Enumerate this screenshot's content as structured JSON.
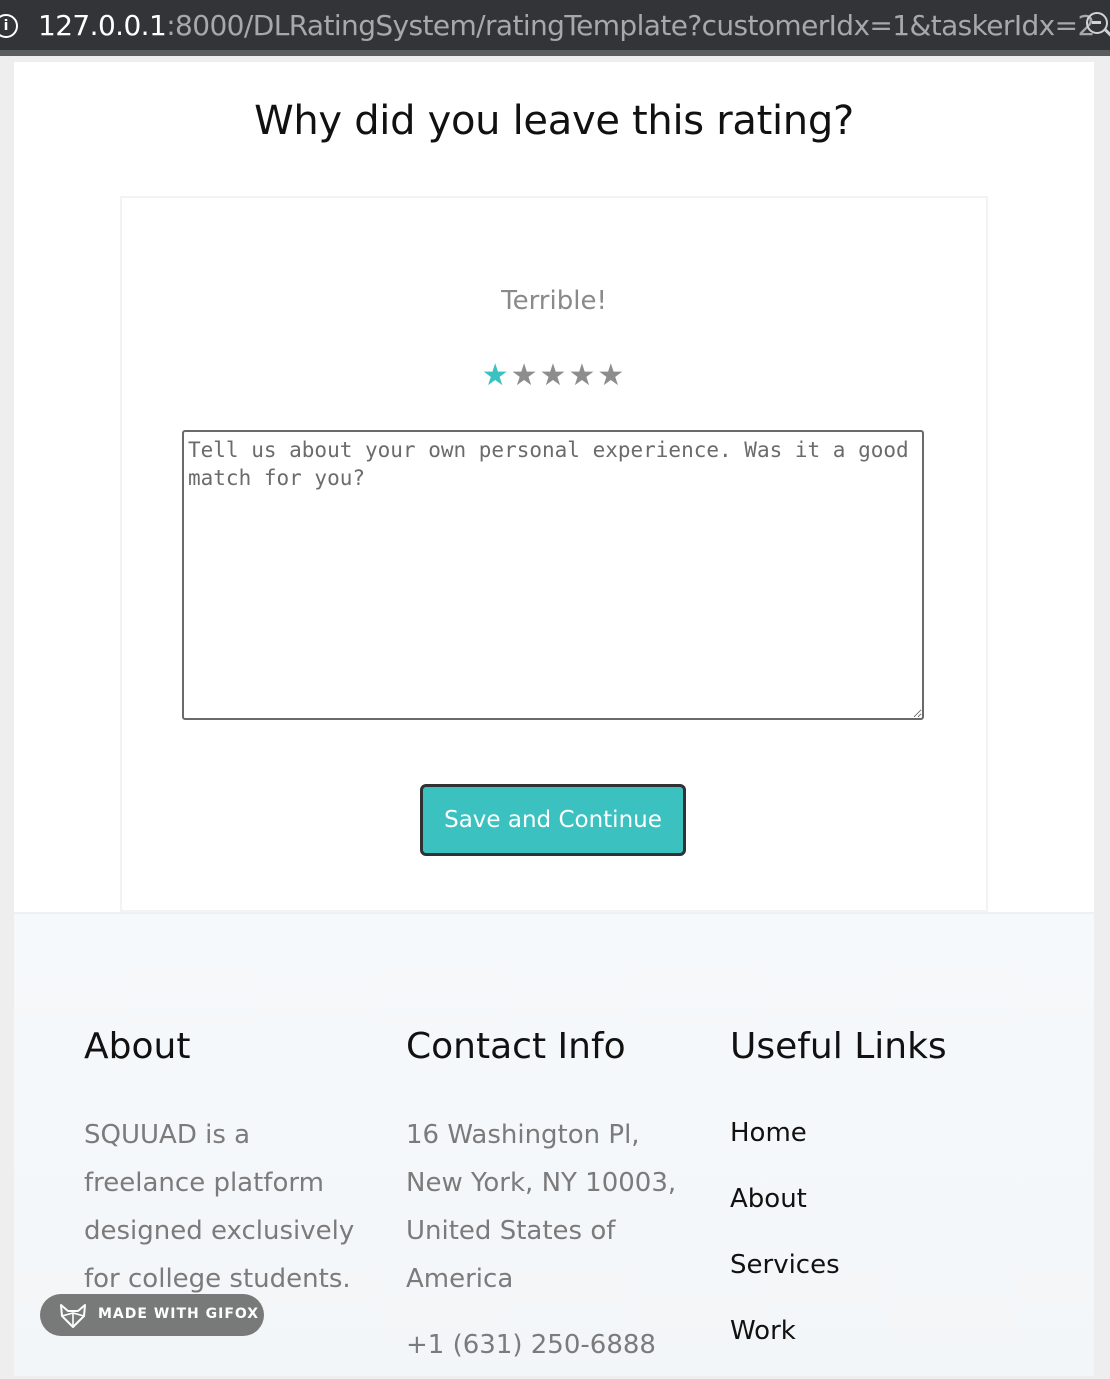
{
  "browser": {
    "url_host": "127.0.0.1",
    "url_rest": ":8000/DLRatingSystem/ratingTemplate?customerIdx=1&taskerIdx=2"
  },
  "main": {
    "heading": "Why did you leave this rating?",
    "rating_label": "Terrible!",
    "rating": {
      "value": 1,
      "max": 5
    },
    "stars": [
      "★",
      "★",
      "★",
      "★",
      "★"
    ],
    "comment_placeholder": "Tell us about your own personal experience. Was it a good match for you?",
    "save_button": "Save and Continue"
  },
  "footer": {
    "about_title": "About",
    "about_text": "SQUUAD is a freelance platform designed exclusively for college students.",
    "contact_title": "Contact Info",
    "contact_address": "16 Washington Pl, New York, NY 10003, United States of America",
    "contact_phone": "+1 (631) 250-6888",
    "links_title": "Useful Links",
    "links": [
      "Home",
      "About",
      "Services",
      "Work"
    ]
  },
  "badge": {
    "text": "MADE WITH GIFOX"
  },
  "colors": {
    "accent": "#3cc1c1",
    "star_inactive": "#8d8d8d"
  },
  "icons": {
    "site_info": "info-icon",
    "zoom": "zoom-icon",
    "badge": "fox-logo-icon"
  }
}
